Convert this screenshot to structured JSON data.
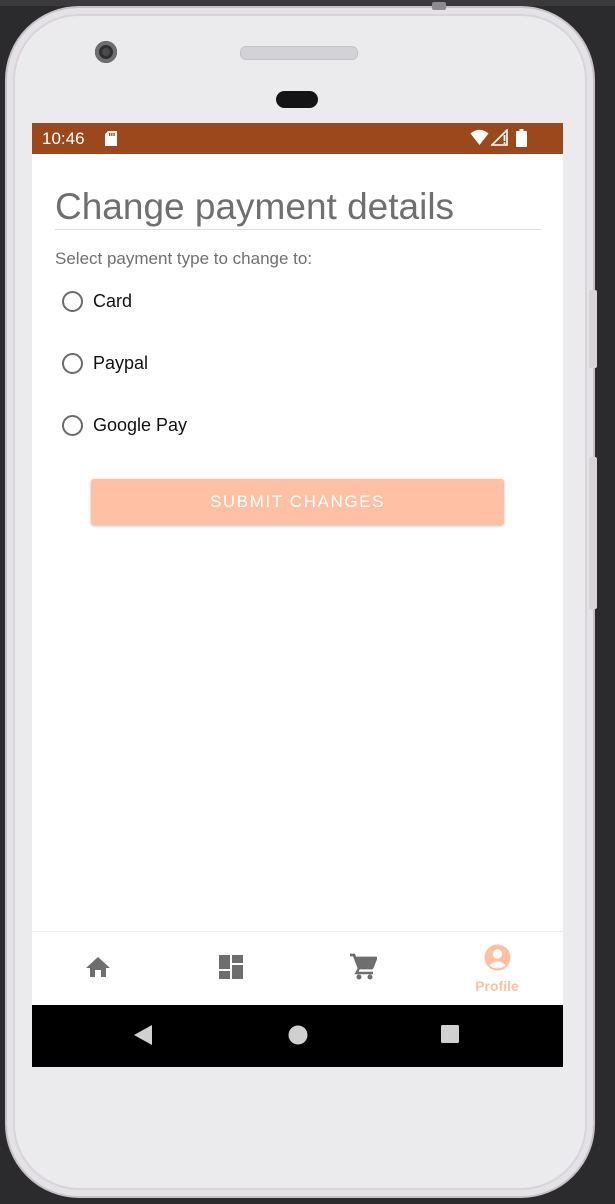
{
  "status_bar": {
    "time": "10:46",
    "background": "#9b481d",
    "icons": [
      "sd-card-icon",
      "wifi-icon",
      "signal-icon",
      "battery-icon"
    ]
  },
  "page": {
    "title": "Change payment details",
    "prompt": "Select payment type to change to:",
    "options": [
      {
        "label": "Card",
        "selected": false
      },
      {
        "label": "Paypal",
        "selected": false
      },
      {
        "label": "Google Pay",
        "selected": false
      }
    ],
    "submit_label": "SUBMIT CHANGES",
    "submit_enabled": false
  },
  "bottom_nav": {
    "items": [
      {
        "icon": "home-icon",
        "label": ""
      },
      {
        "icon": "dashboard-icon",
        "label": ""
      },
      {
        "icon": "cart-icon",
        "label": ""
      },
      {
        "icon": "profile-icon",
        "label": "Profile",
        "active": true
      }
    ],
    "active_color": "#ffc0a4",
    "inactive_color": "#6e6e6e"
  },
  "system_nav": {
    "buttons": [
      "back-icon",
      "home-circle-icon",
      "recents-icon"
    ]
  },
  "colors": {
    "accent": "#ffc0a4",
    "status_bar": "#9b481d"
  }
}
